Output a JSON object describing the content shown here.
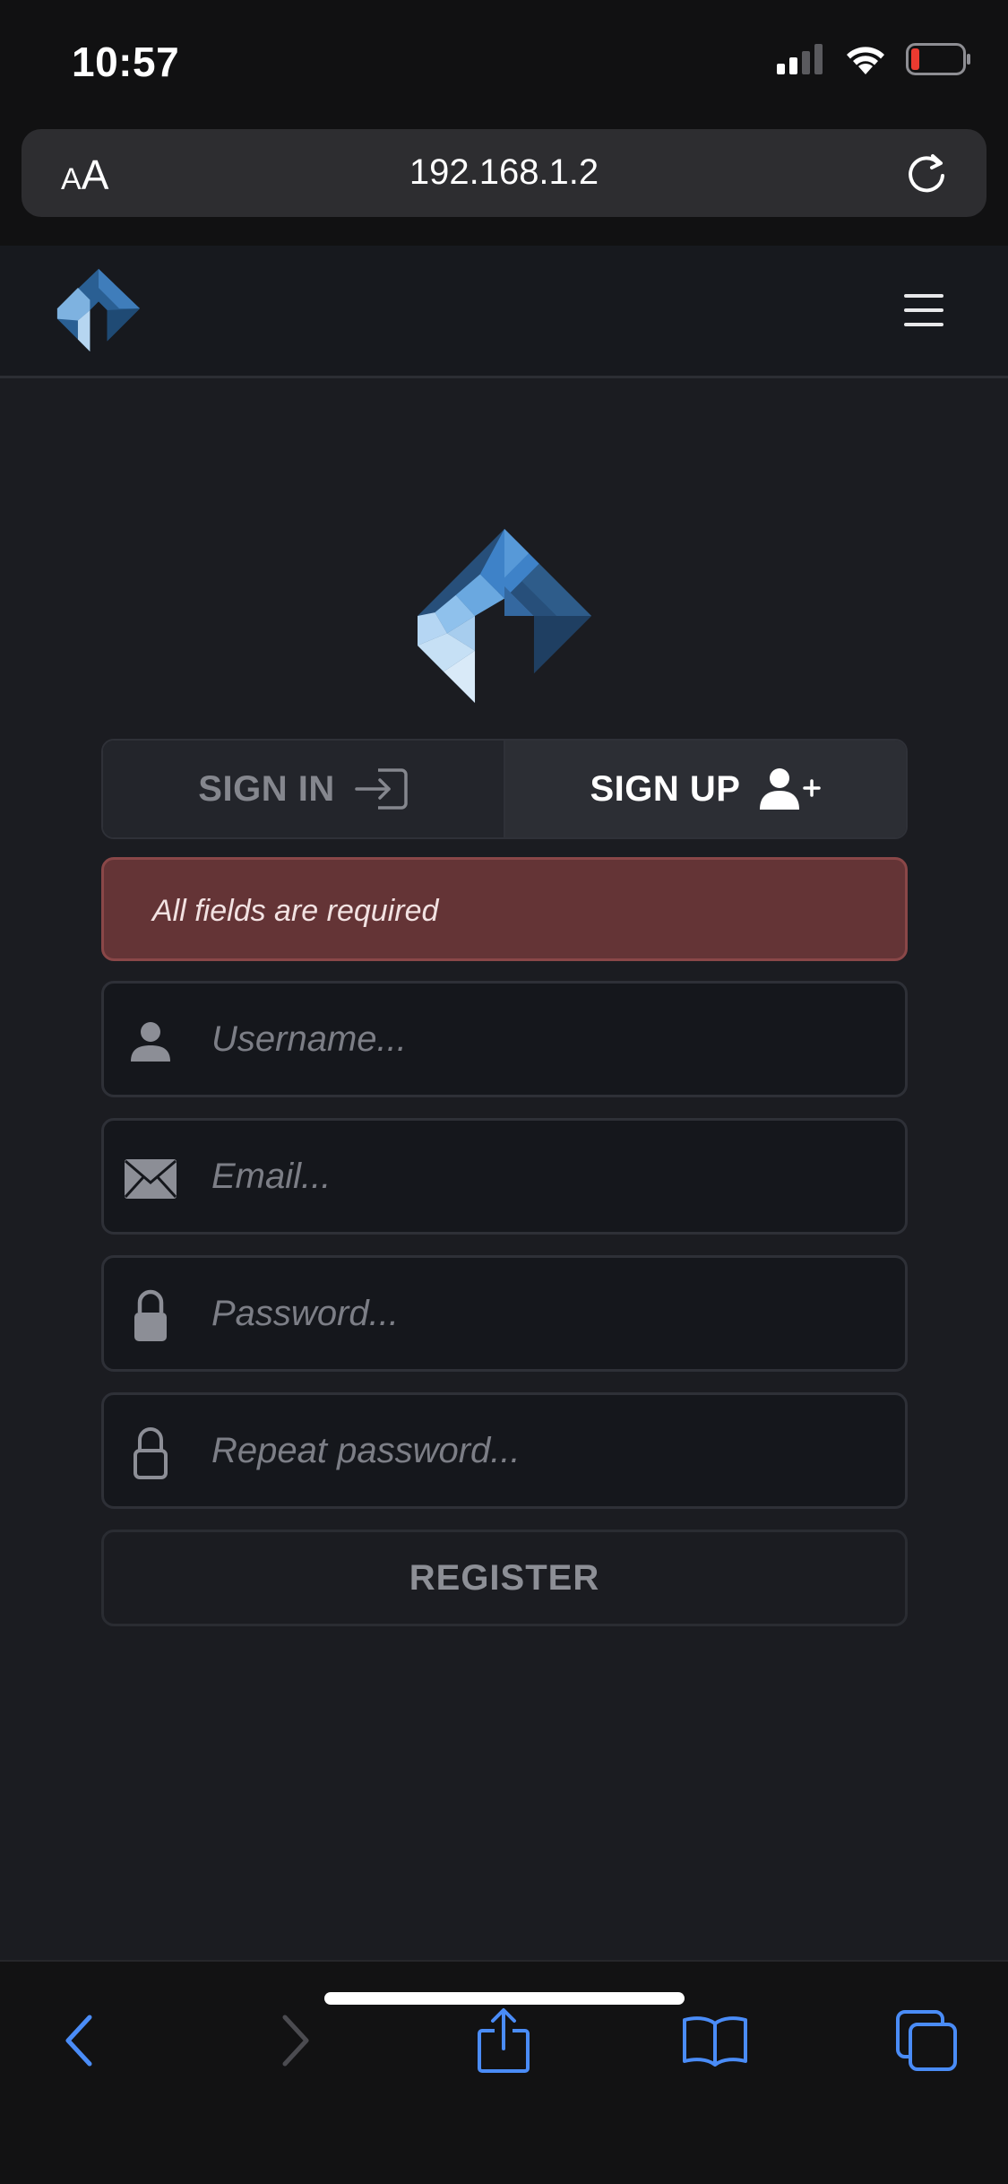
{
  "status_bar": {
    "time": "10:57"
  },
  "browser": {
    "aa_label_small": "A",
    "aa_label_large": "A",
    "url": "192.168.1.2"
  },
  "tabs": {
    "signin_label": "SIGN IN",
    "signup_label": "SIGN UP",
    "active": "signup"
  },
  "alert": {
    "message": "All fields are required"
  },
  "form": {
    "username_placeholder": "Username...",
    "username_value": "",
    "email_placeholder": "Email...",
    "email_value": "",
    "password_placeholder": "Password...",
    "password_value": "",
    "repeat_password_placeholder": "Repeat password...",
    "repeat_password_value": "",
    "register_label": "REGISTER"
  },
  "colors": {
    "page_bg": "#1b1c21",
    "alert_bg": "#643436",
    "accent_blue": "#3d7cc9",
    "ios_blue": "#4a8cf7"
  },
  "icons": {
    "signin": "sign-in-icon",
    "signup": "user-plus-icon",
    "username": "user-icon",
    "email": "envelope-icon",
    "password": "lock-icon",
    "repeat_password": "lock-outline-icon"
  }
}
